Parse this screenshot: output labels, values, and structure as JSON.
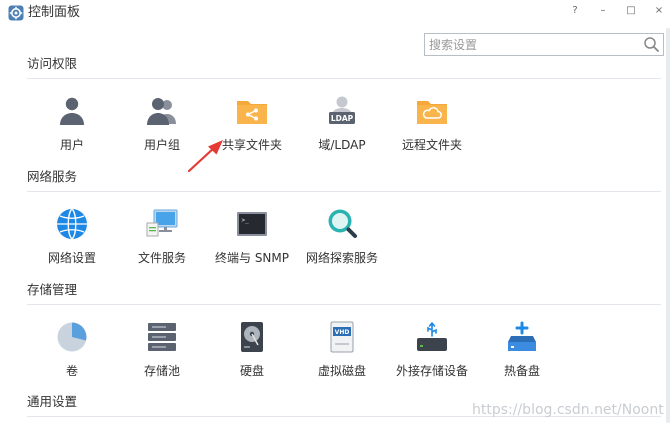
{
  "window": {
    "title": "控制面板",
    "help": "?",
    "minimize": "–",
    "maximize": "□",
    "close": "×"
  },
  "search": {
    "placeholder": "搜索设置",
    "value": ""
  },
  "sections": [
    {
      "title": "访问权限",
      "items": [
        {
          "label": "用户",
          "icon": "user-icon"
        },
        {
          "label": "用户组",
          "icon": "user-group-icon"
        },
        {
          "label": "共享文件夹",
          "icon": "shared-folder-icon"
        },
        {
          "label": "域/LDAP",
          "icon": "ldap-icon"
        },
        {
          "label": "远程文件夹",
          "icon": "remote-folder-icon"
        }
      ]
    },
    {
      "title": "网络服务",
      "items": [
        {
          "label": "网络设置",
          "icon": "globe-icon"
        },
        {
          "label": "文件服务",
          "icon": "file-service-icon"
        },
        {
          "label": "终端与 SNMP",
          "icon": "terminal-icon"
        },
        {
          "label": "网络探索服务",
          "icon": "discovery-icon"
        }
      ]
    },
    {
      "title": "存储管理",
      "items": [
        {
          "label": "卷",
          "icon": "volume-icon"
        },
        {
          "label": "存储池",
          "icon": "storage-pool-icon"
        },
        {
          "label": "硬盘",
          "icon": "hard-disk-icon"
        },
        {
          "label": "虚拟磁盘",
          "icon": "virtual-disk-icon"
        },
        {
          "label": "外接存储设备",
          "icon": "external-storage-icon"
        },
        {
          "label": "热备盘",
          "icon": "hot-spare-icon"
        }
      ]
    },
    {
      "title": "通用设置",
      "items": []
    }
  ],
  "icon_badges": {
    "ldap": "LDAP",
    "vhd": "VHD",
    "terminal": ">_"
  },
  "watermark": "https://blog.csdn.net/Noont",
  "colors": {
    "folder": "#f9b54c",
    "accent": "#1e88e5",
    "arrow": "#e53935",
    "icon_gray": "#5b6270"
  }
}
